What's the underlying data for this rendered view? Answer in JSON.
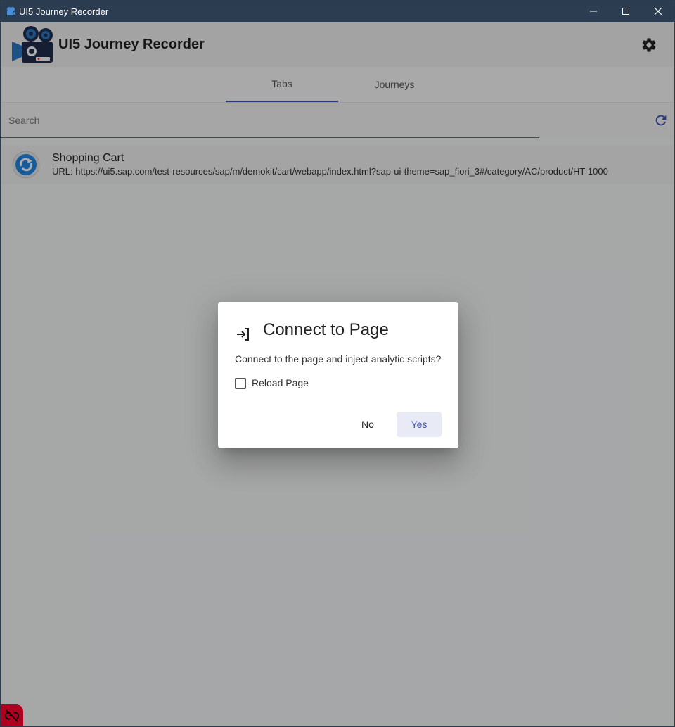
{
  "window": {
    "title": "UI5 Journey Recorder",
    "icon": "app-camera-icon",
    "controls": [
      "minimize-icon",
      "maximize-icon",
      "close-icon"
    ]
  },
  "header": {
    "title": "UI5 Journey Recorder",
    "logo": "camera-logo-icon",
    "settings_icon": "gear-icon"
  },
  "tabs": [
    {
      "label": "Tabs",
      "active": true
    },
    {
      "label": "Journeys",
      "active": false
    }
  ],
  "search": {
    "placeholder": "Search",
    "value": "",
    "refresh_icon": "refresh-icon"
  },
  "list": [
    {
      "title": "Shopping Cart",
      "url": "URL:  https://ui5.sap.com/test-resources/sap/m/demokit/cart/webapp/index.html?sap-ui-theme=sap_fiori_3#/category/AC/product/HT-1000",
      "icon": "page-icon"
    }
  ],
  "dialog": {
    "title": "Connect to Page",
    "icon": "login-icon",
    "text": "Connect to the page and inject analytic scripts?",
    "checkbox_label": "Reload Page",
    "checkbox_checked": false,
    "no_label": "No",
    "yes_label": "Yes"
  },
  "status": {
    "icon": "link-off-icon"
  },
  "colors": {
    "accent": "#3f51b5",
    "titlebar": "#2c3d52",
    "status_disconnected": "#b00020"
  }
}
